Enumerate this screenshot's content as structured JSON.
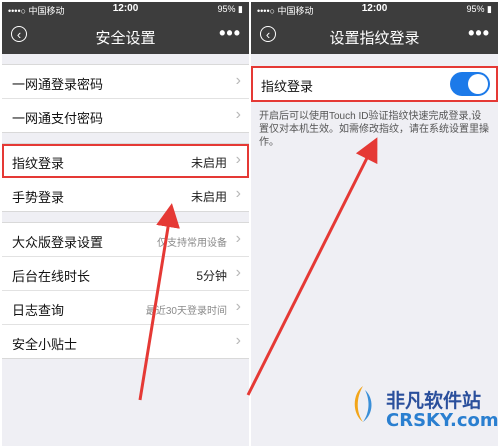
{
  "status": {
    "carrier": "••••○ 中国移动",
    "time": "12:00",
    "battery": "95%"
  },
  "left_screen": {
    "title": "安全设置",
    "more": "•••",
    "group1": [
      {
        "label": "一网通登录密码",
        "value": ""
      },
      {
        "label": "一网通支付密码",
        "value": ""
      }
    ],
    "group2": [
      {
        "label": "指纹登录",
        "value": "未启用"
      },
      {
        "label": "手势登录",
        "value": "未启用"
      }
    ],
    "group3": [
      {
        "label": "大众版登录设置",
        "value": "仅支持常用设备"
      },
      {
        "label": "后台在线时长",
        "value": "5分钟"
      },
      {
        "label": "日志查询",
        "value": "最近30天登录时间"
      },
      {
        "label": "安全小贴士",
        "value": ""
      }
    ]
  },
  "right_screen": {
    "title": "设置指纹登录",
    "more": "•••",
    "fingerprint_label": "指纹登录",
    "toggle_state": "on",
    "accent_color": "#1c7ae9",
    "description": "开启后可以使用Touch ID验证指纹快速完成登录,设置仅对本机生效。如需修改指纹，请在系统设置里操作。"
  },
  "watermark": {
    "name": "非凡软件站",
    "domain": "CRSKY.com"
  },
  "highlight_color": "#e53935"
}
